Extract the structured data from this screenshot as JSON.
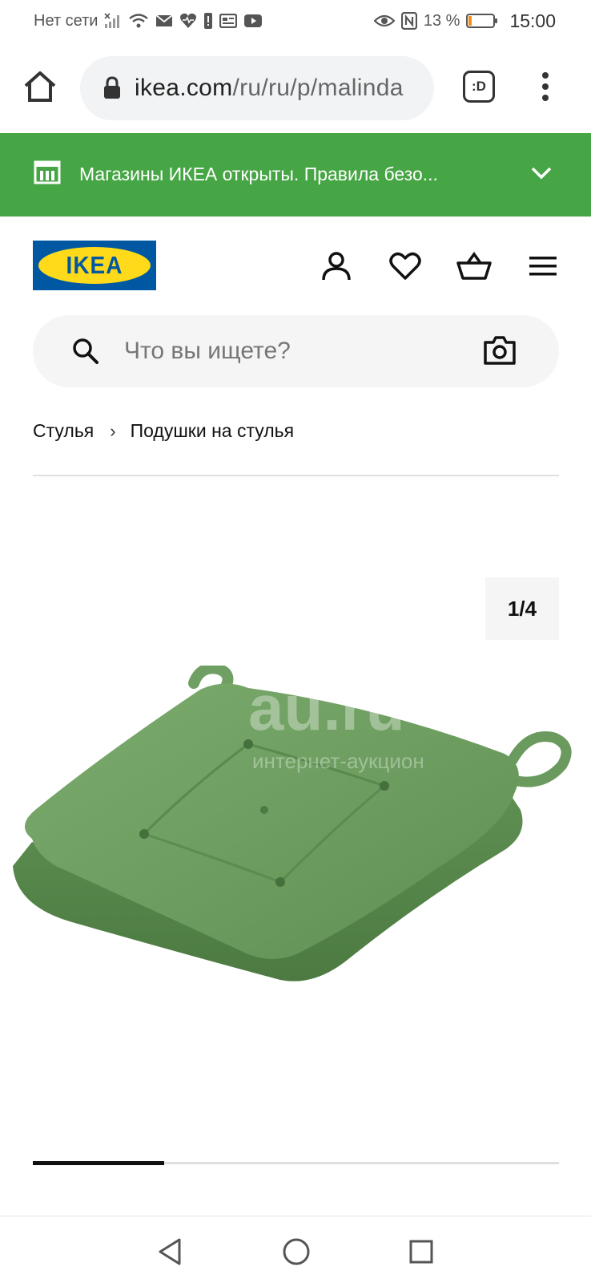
{
  "status_bar": {
    "carrier": "Нет сети",
    "battery_percent": "13 %",
    "battery_level": 0.13,
    "time": "15:00",
    "icons": [
      "signal-icon",
      "wifi-icon",
      "mail-icon",
      "health-icon",
      "alert-icon",
      "news-icon",
      "youtube-icon",
      "eye-icon",
      "nfc-icon",
      "battery-icon"
    ]
  },
  "browser": {
    "url_host": "ikea.com",
    "url_path": "/ru/ru/p/malinda",
    "tabs_label": ":D"
  },
  "banner": {
    "text": "Магазины ИКЕА открыты. Правила безо...",
    "color": "#46a544"
  },
  "header": {
    "logo_text": "IKEA",
    "logo_colors": {
      "blue": "#0058a3",
      "yellow": "#ffda1a"
    }
  },
  "search": {
    "placeholder": "Что вы ищете?"
  },
  "breadcrumb": {
    "items": [
      "Стулья",
      "Подушки на стулья"
    ],
    "separator": "›"
  },
  "gallery": {
    "counter": "1/4",
    "progress": 0.25,
    "watermark_main": "au.ru",
    "watermark_sub": "интернет-аукцион",
    "product_color": "#6b9a5e"
  }
}
